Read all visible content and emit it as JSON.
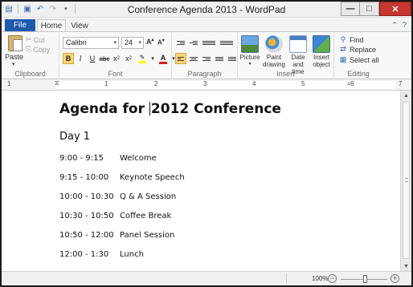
{
  "window": {
    "title": "Conference Agenda 2013 - WordPad",
    "controls": {
      "minimize": "—",
      "maximize": "□",
      "close": "✕"
    }
  },
  "quick_access": [
    "save-icon",
    "undo-icon",
    "redo-icon",
    "customize-icon"
  ],
  "ribbon": {
    "tabs": {
      "file": "File",
      "home": "Home",
      "view": "View"
    },
    "clipboard": {
      "paste": "Paste",
      "cut": "Cut",
      "copy": "Copy",
      "label": "Clipboard"
    },
    "font": {
      "name": "Calibri",
      "size": "24",
      "label": "Font"
    },
    "paragraph": {
      "label": "Paragraph"
    },
    "insert": {
      "picture": "Picture",
      "paint_line1": "Paint",
      "paint_line2": "drawing",
      "date_line1": "Date and",
      "date_line2": "time",
      "object_line1": "Insert",
      "object_line2": "object",
      "label": "Insert"
    },
    "editing": {
      "find": "Find",
      "replace": "Replace",
      "select_all": "Select all",
      "label": "Editing"
    }
  },
  "ruler": {
    "numbers": [
      "1",
      "1",
      "2",
      "3",
      "4",
      "5",
      "6",
      "7"
    ]
  },
  "document": {
    "title_before_caret": "Agenda for ",
    "title_after_caret": "2012 Conference",
    "day": "Day 1",
    "agenda": [
      {
        "time": "9:00 - 9:15",
        "item": "Welcome"
      },
      {
        "time": "9:15 - 10:00",
        "item": "Keynote Speech"
      },
      {
        "time": "10:00 - 10:30",
        "item": "Q & A Session"
      },
      {
        "time": "10:30 - 10:50",
        "item": "Coffee Break"
      },
      {
        "time": "10:50 - 12:00",
        "item": "Panel Session"
      },
      {
        "time": "12:00 - 1:30",
        "item": "Lunch"
      }
    ]
  },
  "status": {
    "zoom": "100%"
  },
  "colors": {
    "file_tab": "#1c5aab",
    "close_button": "#c7372f",
    "active_button": "#fbd37a"
  }
}
